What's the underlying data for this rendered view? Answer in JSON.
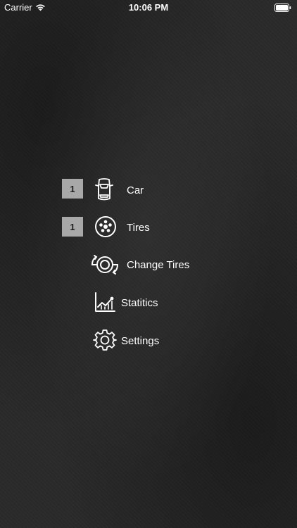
{
  "status_bar": {
    "carrier": "Carrier",
    "time": "10:06 PM"
  },
  "menu": {
    "items": [
      {
        "label": "Car",
        "badge": "1",
        "icon": "car-icon"
      },
      {
        "label": "Tires",
        "badge": "1",
        "icon": "tire-icon"
      },
      {
        "label": "Change Tires",
        "icon": "change-tires-icon"
      },
      {
        "label": "Statitics",
        "icon": "statistics-chart-icon"
      },
      {
        "label": "Settings",
        "icon": "gear-icon"
      }
    ]
  },
  "colors": {
    "background": "#2a2a2a",
    "badge": "#a8a8a8",
    "text": "#ffffff"
  }
}
